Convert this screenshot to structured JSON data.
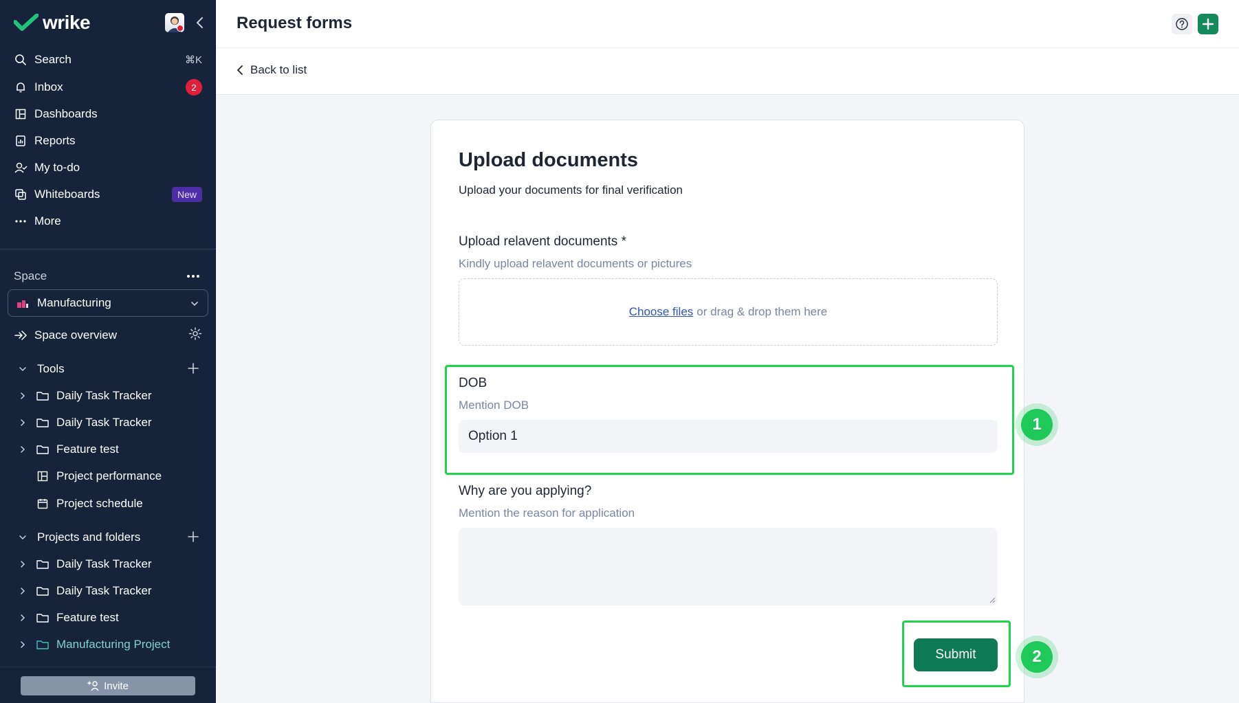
{
  "brand": {
    "name": "wrike"
  },
  "nav": {
    "search": {
      "label": "Search",
      "shortcut": "⌘K"
    },
    "inbox": {
      "label": "Inbox",
      "badge": "2"
    },
    "dashboards": {
      "label": "Dashboards"
    },
    "reports": {
      "label": "Reports"
    },
    "todo": {
      "label": "My to-do"
    },
    "whiteboards": {
      "label": "Whiteboards",
      "badge": "New"
    },
    "more": {
      "label": "More"
    }
  },
  "space": {
    "label": "Space",
    "selected": "Manufacturing",
    "overview": "Space overview"
  },
  "tools": {
    "label": "Tools",
    "items": [
      {
        "label": "Daily Task Tracker",
        "icon": "folder-icon"
      },
      {
        "label": "Daily Task Tracker",
        "icon": "folder-icon"
      },
      {
        "label": "Feature test",
        "icon": "folder-icon"
      },
      {
        "label": "Project performance",
        "icon": "dashboard-icon"
      },
      {
        "label": "Project schedule",
        "icon": "calendar-icon"
      }
    ]
  },
  "projects": {
    "label": "Projects and folders",
    "items": [
      {
        "label": "Daily Task Tracker",
        "icon": "folder-icon"
      },
      {
        "label": "Daily Task Tracker",
        "icon": "folder-icon"
      },
      {
        "label": "Feature test",
        "icon": "folder-icon"
      },
      {
        "label": "Manufacturing Project",
        "icon": "folder-icon"
      }
    ]
  },
  "invite": {
    "label": "Invite"
  },
  "header": {
    "title": "Request forms",
    "back": "Back to list"
  },
  "form": {
    "title": "Upload documents",
    "description": "Upload your documents for final verification",
    "upload": {
      "label": "Upload relavent documents *",
      "hint": "Kindly upload relavent documents or pictures",
      "choose": "Choose files",
      "drop": "or drag & drop them here"
    },
    "dob": {
      "label": "DOB",
      "hint": "Mention DOB",
      "value": "Option 1"
    },
    "why": {
      "label": "Why are you applying?",
      "hint": "Mention the reason for application",
      "value": ""
    },
    "submit": "Submit"
  },
  "annotations": {
    "one": "1",
    "two": "2"
  },
  "colors": {
    "sidebar": "#17233a",
    "accent": "#0e7a55",
    "highlight": "#1fd44a"
  }
}
